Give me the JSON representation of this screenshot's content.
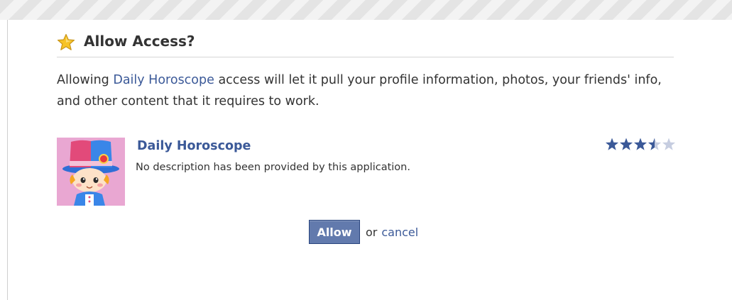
{
  "dialog": {
    "title": "Allow Access?",
    "title_icon": "star-icon",
    "description": {
      "prefix": "Allowing ",
      "app_link": "Daily Horoscope",
      "suffix": " access will let it pull your profile information, photos, your friends' info, and other content that it requires to work."
    }
  },
  "app": {
    "name": "Daily Horoscope",
    "description": "No description has been provided by this application.",
    "icon": "horoscope-character-avatar",
    "rating": 3.5,
    "rating_max": 5
  },
  "actions": {
    "allow_label": "Allow",
    "or_text": "or",
    "cancel_label": "cancel"
  },
  "colors": {
    "link": "#3b5998",
    "button": "#627aad",
    "star_filled": "#3b5998",
    "star_empty": "#c6cde0"
  }
}
